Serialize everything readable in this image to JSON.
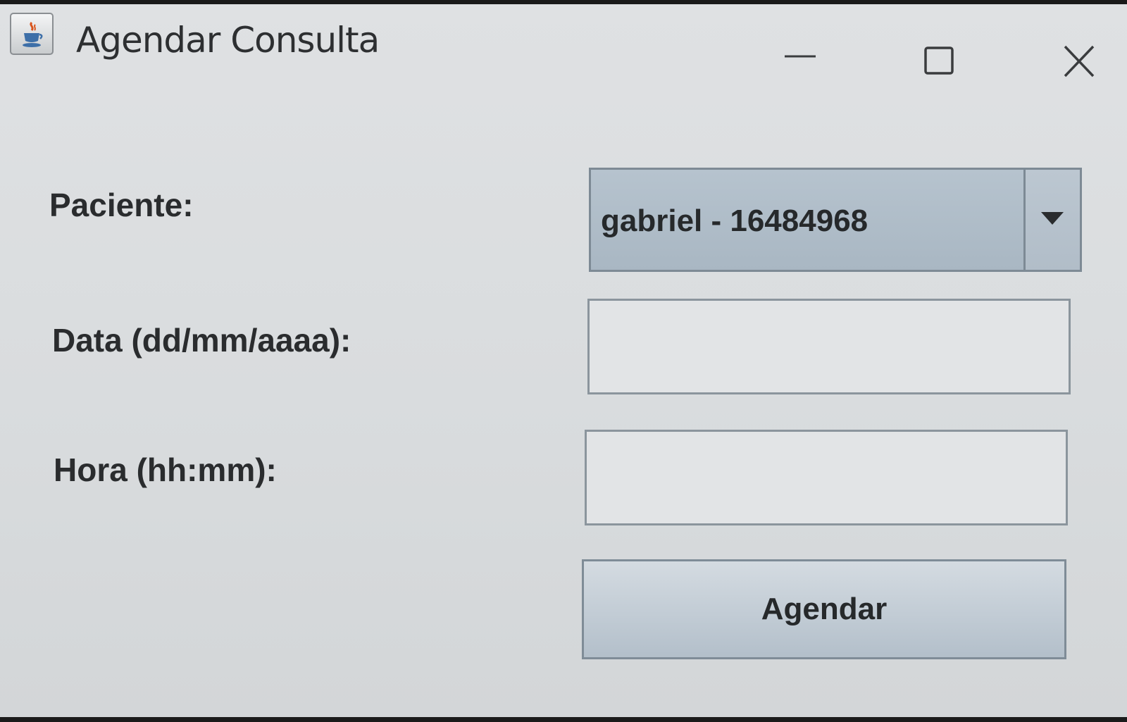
{
  "window": {
    "title": "Agendar Consulta",
    "controls": [
      "minimize-icon",
      "maximize-icon",
      "close-icon"
    ],
    "app_icon": "java-cup-icon"
  },
  "form": {
    "paciente_label": "Paciente:",
    "paciente_selected": "gabriel - 16484968",
    "data_label": "Data (dd/mm/aaaa):",
    "data_value": "",
    "hora_label": "Hora (hh:mm):",
    "hora_value": "",
    "submit_label": "Agendar"
  },
  "colors": {
    "window_bg": "#dcdfe1",
    "selection_bg": "#adbac6",
    "border": "#7d8a95",
    "text": "#2a2c2e"
  }
}
